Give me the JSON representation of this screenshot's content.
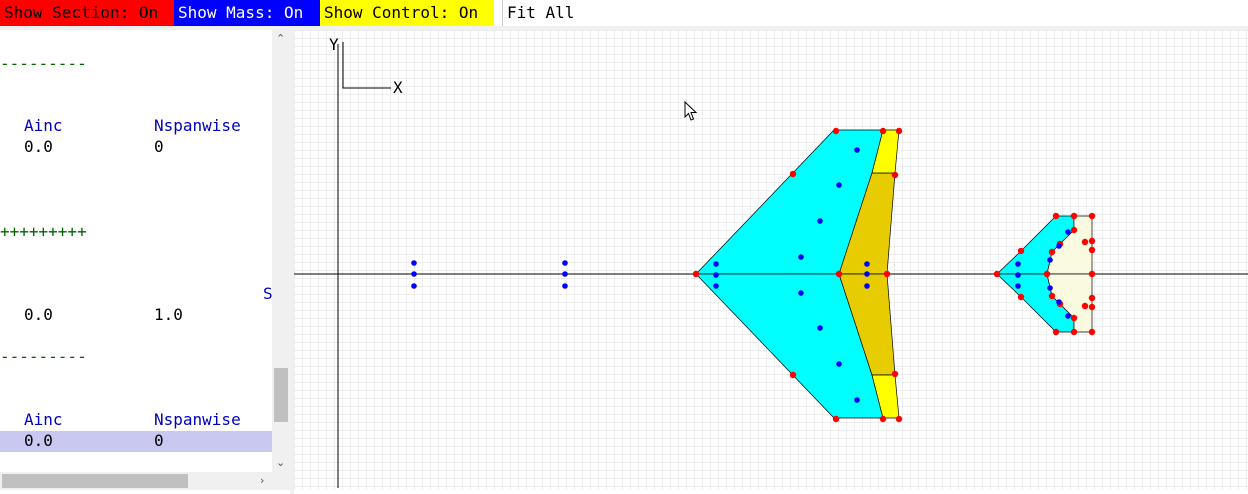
{
  "toolbar": {
    "show_section": "Show Section: On",
    "show_mass": "Show Mass: On",
    "show_control": "Show Control: On",
    "fit_all": "Fit All"
  },
  "left_panel": {
    "dash_line": "---------",
    "plus_line": "+++++++++",
    "header_ainc": "Ainc",
    "header_nspanwise": "Nspanwise",
    "row1_ainc": "0.0",
    "row1_nspanwise": "0",
    "row2_a": "0.0",
    "row2_b": "1.0",
    "partial_char": "S",
    "row3_ainc": "0.0",
    "row3_nspanwise": "0"
  },
  "axes": {
    "x_label": "X",
    "y_label": "Y"
  },
  "colors": {
    "section_on": "#ff0000",
    "mass_on": "#0000ff",
    "control_on": "#ffff00",
    "wing_fill": "#00ffff",
    "control_fill": "#ffff00",
    "control_fill_dark": "#e6cc00",
    "tail_control_fill": "#fafae0",
    "highlight_row": "#c8c8f0"
  },
  "icons": [
    "chevron-up-icon",
    "chevron-down-icon",
    "chevron-right-icon",
    "mouse-cursor-icon"
  ]
}
